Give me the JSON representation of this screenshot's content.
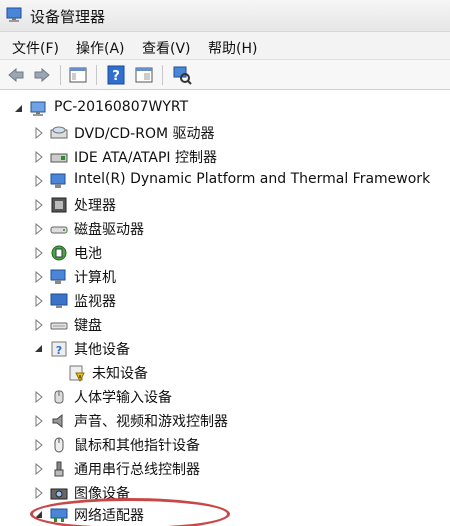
{
  "window": {
    "title": "设备管理器"
  },
  "menu": [
    "文件(F)",
    "操作(A)",
    "查看(V)",
    "帮助(H)"
  ],
  "toolbar": {
    "buttons": [
      "back-icon",
      "forward-icon",
      "properties-icon",
      "help-icon",
      "console-icon",
      "scan-hardware-icon"
    ]
  },
  "tree": {
    "root": "PC-20160807WYRT",
    "items": [
      {
        "label": "DVD/CD-ROM 驱动器",
        "icon": "dvd-drive-icon"
      },
      {
        "label": "IDE ATA/ATAPI 控制器",
        "icon": "ide-controller-icon"
      },
      {
        "label": "Intel(R) Dynamic Platform and Thermal Framework",
        "icon": "intel-framework-icon"
      },
      {
        "label": "处理器",
        "icon": "processor-icon"
      },
      {
        "label": "磁盘驱动器",
        "icon": "disk-drive-icon"
      },
      {
        "label": "电池",
        "icon": "battery-icon"
      },
      {
        "label": "计算机",
        "icon": "computer-icon"
      },
      {
        "label": "监视器",
        "icon": "monitor-icon"
      },
      {
        "label": "键盘",
        "icon": "keyboard-icon"
      },
      {
        "label": "其他设备",
        "icon": "other-devices-icon",
        "expanded": true
      },
      {
        "label": "未知设备",
        "icon": "unknown-device-icon",
        "child": true
      },
      {
        "label": "人体学输入设备",
        "icon": "hid-icon"
      },
      {
        "label": "声音、视频和游戏控制器",
        "icon": "sound-icon"
      },
      {
        "label": "鼠标和其他指针设备",
        "icon": "mouse-icon"
      },
      {
        "label": "通用串行总线控制器",
        "icon": "usb-icon"
      },
      {
        "label": "图像设备",
        "icon": "camera-icon"
      },
      {
        "label": "网络适配器",
        "icon": "network-adapter-icon",
        "expanded": true
      }
    ]
  },
  "colors": {
    "highlight": "#c84848",
    "accent": "#2f6fd0"
  }
}
